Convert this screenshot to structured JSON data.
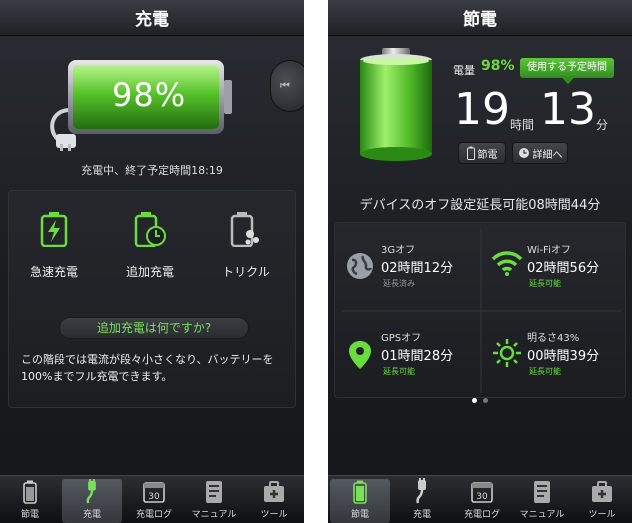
{
  "screenA": {
    "title": "充電",
    "battery_percent": "98%",
    "status": "充電中、終了予定時間18:19",
    "modes": [
      {
        "label": "急速充電",
        "icon": "battery-bolt-icon"
      },
      {
        "label": "追加充電",
        "icon": "battery-clock-icon"
      },
      {
        "label": "トリクル",
        "icon": "battery-drops-icon"
      }
    ],
    "help_link": "追加充電は何ですか?",
    "description": "この階段では電流が段々小さくなり、バッテリーを100%までフル充電できます。",
    "tabs": [
      {
        "label": "節電",
        "icon": "battery-icon"
      },
      {
        "label": "充電",
        "icon": "plug-icon"
      },
      {
        "label": "充電ログ",
        "icon": "calendar-icon",
        "calendar_number": "30"
      },
      {
        "label": "マニュアル",
        "icon": "manual-icon"
      },
      {
        "label": "ツール",
        "icon": "toolbox-icon"
      }
    ],
    "active_tab": 1
  },
  "screenB": {
    "title": "節電",
    "charge_label": "電量",
    "charge_value": "98%",
    "remaining_button": "使用する予定時間",
    "hours": "19",
    "hours_unit": "時間",
    "minutes": "13",
    "minutes_unit": "分",
    "save_button": "節電",
    "detail_button": "詳細へ",
    "extension_text": "デバイスのオフ設定延長可能08時間44分",
    "cells": [
      {
        "title": "3Gオフ",
        "time": "02時間12分",
        "note": "延長済み",
        "icon": "globe-icon"
      },
      {
        "title": "Wi-Fiオフ",
        "time": "02時間56分",
        "note": "延長可能",
        "icon": "wifi-icon"
      },
      {
        "title": "GPSオフ",
        "time": "01時間28分",
        "note": "延長可能",
        "icon": "location-pin-icon"
      },
      {
        "title": "明るさ43%",
        "time": "00時間39分",
        "note": "延長可能",
        "icon": "brightness-icon"
      }
    ],
    "tabs": [
      {
        "label": "節電",
        "icon": "battery-icon"
      },
      {
        "label": "充電",
        "icon": "plug-icon"
      },
      {
        "label": "充電ログ",
        "icon": "calendar-icon",
        "calendar_number": "30"
      },
      {
        "label": "マニュアル",
        "icon": "manual-icon"
      },
      {
        "label": "ツール",
        "icon": "toolbox-icon"
      }
    ],
    "active_tab": 0
  },
  "colors": {
    "accent_green": "#6bdc3e",
    "background": "#1b1d21"
  }
}
